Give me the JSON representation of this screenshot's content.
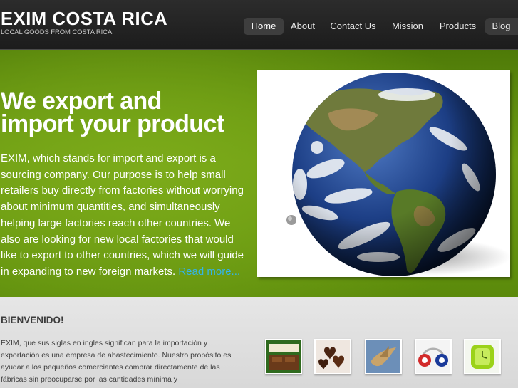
{
  "header": {
    "logo": "EXIM COSTA RICA",
    "tagline": "LOCAL GOODS FROM COSTA RICA"
  },
  "nav": [
    {
      "label": "Home",
      "active": true
    },
    {
      "label": "About"
    },
    {
      "label": "Contact Us"
    },
    {
      "label": "Mission"
    },
    {
      "label": "Products"
    },
    {
      "label": "Blog"
    }
  ],
  "hero": {
    "title": "We export and\nimport your product",
    "body": "EXIM, which stands for import and export is a sourcing company. Our purpose is to help small retailers buy directly from factories without worrying about minimum quantities, and simultaneously helping large factories reach other countries. We also are looking for new local factories that would like to export to other countries, which we will guide in expanding to new foreign markets.",
    "read_more": "Read more...",
    "image_icon": "globe-icon"
  },
  "welcome": {
    "title": "BIENVENIDO!",
    "text": "EXIM, que sus siglas en ingles significan para la importación y exportación es una empresa de abastecimiento. Nuestro propósito es ayudar a los pequeños comerciantes comprar directamente de las fábricas sin preocuparse por las cantidades mínima y"
  },
  "thumbnails": [
    {
      "icon": "chocolate-bar-icon"
    },
    {
      "icon": "heart-chocolates-icon"
    },
    {
      "icon": "wooden-bird-icon"
    },
    {
      "icon": "headphones-icon"
    },
    {
      "icon": "green-watch-icon"
    }
  ],
  "colors": {
    "link": "#35b4e6",
    "hero_green": "#6d9c12",
    "header_dark": "#2c2c2c"
  }
}
